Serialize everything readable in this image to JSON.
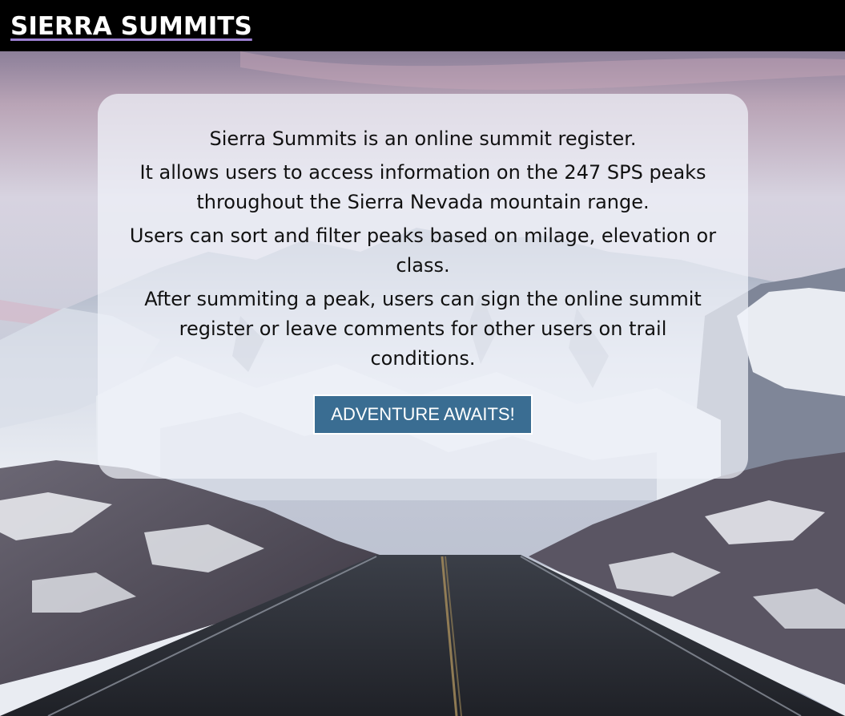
{
  "header": {
    "logo_text": "SIERRA SUMMITS"
  },
  "intro": {
    "paragraphs": [
      "Sierra Summits is an online summit register.",
      "It allows users to access information on the 247 SPS peaks throughout the Sierra Nevada mountain range.",
      "Users can sort and filter peaks based on milage, elevation or class.",
      "After summiting a peak, users can sign the online summit register or leave comments for other users on trail conditions."
    ],
    "cta_label": "ADVENTURE AWAITS!"
  },
  "colors": {
    "header_bg": "#000000",
    "logo_underline": "#9b7fd1",
    "button_bg": "#3a6d92",
    "button_text": "#ffffff"
  },
  "background": {
    "icon": "snowy-mountain-road-photo"
  }
}
